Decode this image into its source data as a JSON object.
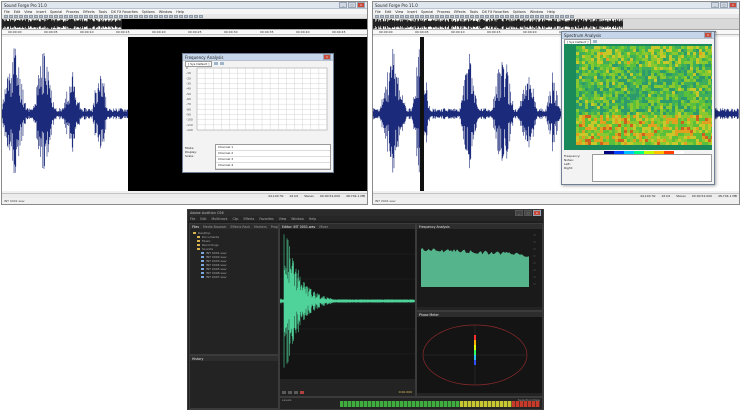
{
  "left_window": {
    "title": "Sound Forge Pro 11.0",
    "menu": [
      "File",
      "Edit",
      "View",
      "Insert",
      "Special",
      "Process",
      "Effects",
      "Tools",
      "DX FX Favorites",
      "Options",
      "Window",
      "Help"
    ],
    "timecodes": [
      "00:00:00",
      "00:00:05",
      "00:00:10",
      "00:00:15",
      "00:00:20",
      "00:00:25",
      "00:00:30",
      "00:00:35",
      "00:00:40",
      "00:00:45"
    ],
    "dialog_title": "Frequency Analysis",
    "dialog_select": "[ Sys Default ]",
    "dialog_rows": [
      "Channel 1",
      "Channel 2",
      "Channel 3",
      "Channel 4"
    ],
    "dialog_yticks": [
      "0",
      "-10",
      "-20",
      "-30",
      "-40",
      "-50",
      "-60",
      "-70",
      "-80",
      "-90",
      "-100",
      "-110",
      "-120"
    ],
    "status": [
      "44,100 Hz",
      "16 bit",
      "Stereo",
      "00:00:52.000",
      "48,744.1 MB"
    ],
    "tab_label": "INT 0001.wav"
  },
  "right_window": {
    "title": "Sound Forge Pro 11.0",
    "menu": [
      "File",
      "Edit",
      "View",
      "Insert",
      "Special",
      "Process",
      "Effects",
      "Tools",
      "DX FX Favorites",
      "Options",
      "Window",
      "Help"
    ],
    "timecodes": [
      "00:00:00",
      "00:00:05",
      "00:00:10",
      "00:00:15",
      "00:00:20",
      "00:00:25",
      "00:00:30",
      "00:00:35",
      "00:00:40",
      "00:00:45"
    ],
    "dialog_title": "Spectrum Analysis",
    "dialog_select": "[ Sys Default ]",
    "info_rows": [
      "Frequency:",
      "Notes:",
      "Left:",
      "Right:"
    ],
    "status": [
      "44,100 Hz",
      "16 bit",
      "Stereo",
      "00:00:52.000",
      "48,744.1 MB"
    ],
    "tab_label": "INT 0001.wav"
  },
  "bottom_window": {
    "title": "Adobe Audition CS6",
    "menu": [
      "File",
      "Edit",
      "Multitrack",
      "Clip",
      "Effects",
      "Favorites",
      "View",
      "Window",
      "Help"
    ],
    "tabs_left": [
      "Files",
      "Media Browser",
      "Effects Rack",
      "Markers",
      "Properties"
    ],
    "editor_tabs": [
      "Editor: INT 0001.wav",
      "Mixer"
    ],
    "right_tabs": [
      "Frequency Analysis",
      "Phase Meter"
    ],
    "file_rows": [
      "Desktop",
      "Documents",
      "Music",
      "Recordings",
      "Sounds",
      "INT 0001.wav",
      "INT 0002.wav",
      "INT 0003.wav",
      "INT 0004.wav",
      "INT 0005.wav",
      "INT 0006.wav",
      "INT 0007.wav"
    ],
    "history_label": "History",
    "levels_label": "Levels",
    "time_display": "0:00.000",
    "selection_label": "Selection/View",
    "colors": {
      "wave": "#4fd39a",
      "bg": "#1e1e1e",
      "spectrum": "#56b48c"
    }
  }
}
